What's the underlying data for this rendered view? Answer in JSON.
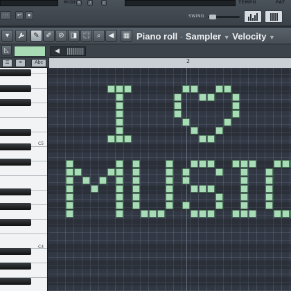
{
  "window": {
    "title_main": "Piano roll",
    "title_separator": " - ",
    "title_channel": "Sampler",
    "title_param": "Velocity"
  },
  "topbar": {
    "labels": [
      "MIDI",
      "TEMPO",
      "PAT",
      "SWING"
    ]
  },
  "toolbar": {
    "tools": [
      "menu-arrow-icon",
      "wrench-icon",
      "pencil-icon",
      "paint-brush-icon",
      "mute-icon",
      "slice-icon",
      "select-icon",
      "zoom-icon",
      "speaker-icon",
      "snap-grid-icon"
    ]
  },
  "view_buttons": {
    "abc_label": "Abc"
  },
  "timeline": {
    "bar_number": "2"
  },
  "keyboard": {
    "octave_labels": [
      "C5",
      "C4"
    ]
  },
  "colors": {
    "note": "#a8dcb6",
    "grid_bg": "#323843",
    "swatch": "#a9dcb4"
  },
  "notes_text": "I ♥ MUSIC"
}
